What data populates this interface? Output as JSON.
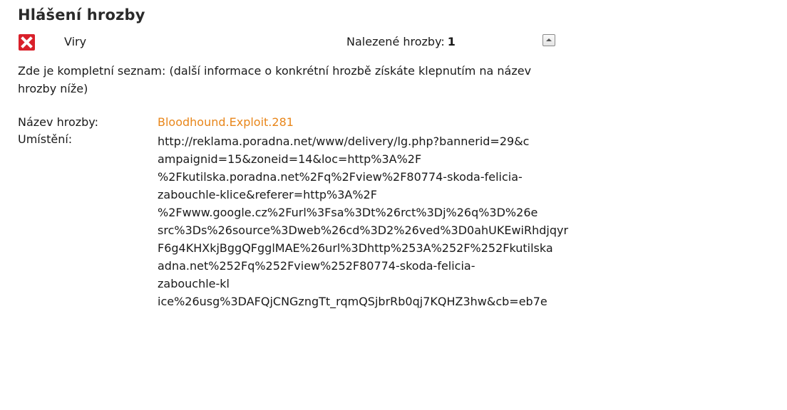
{
  "title": "Hlášení hrozby",
  "threat_group": {
    "icon": "red-x-icon",
    "category": "Viry",
    "found_label": "Nalezené hrozby:",
    "found_count": "1",
    "collapse_icon": "chevron-up-icon"
  },
  "intro_text": "Zde je kompletní seznam: (další informace o konkrétní hrozbě získáte klepnutím na název hrozby níže)",
  "details": {
    "name_label": "Název hrozby:",
    "name_value": "Bloodhound.Exploit.281",
    "location_label": "Umístění:",
    "location_lines": [
      "http://reklama.poradna.net/www/delivery/lg.php?bannerid=29&c",
      "ampaignid=15&zoneid=14&loc=http%3A%2F",
      "%2Fkutilska.poradna.net%2Fq%2Fview%2F80774-skoda-felicia-",
      "zabouchle-klice&referer=http%3A%2F",
      "%2Fwww.google.cz%2Furl%3Fsa%3Dt%26rct%3Dj%26q%3D%26e",
      "src%3Ds%26source%3Dweb%26cd%3D2%26ved%3D0ahUKEwiRhdjqyr",
      "F6g4KHXkjBggQFgglMAE%26url%3Dhttp%253A%252F%252Fkutilska",
      "adna.net%252Fq%252Fview%252F80774-skoda-felicia-",
      "zabouchle-kl",
      "ice%26usg%3DAFQjCNGzngTt_rqmQSjbrRb0qj7KQHZ3hw&cb=eb7e"
    ]
  },
  "colors": {
    "icon_red": "#d9202a",
    "threat_name": "#e8861a",
    "text": "#1a1a1a"
  }
}
